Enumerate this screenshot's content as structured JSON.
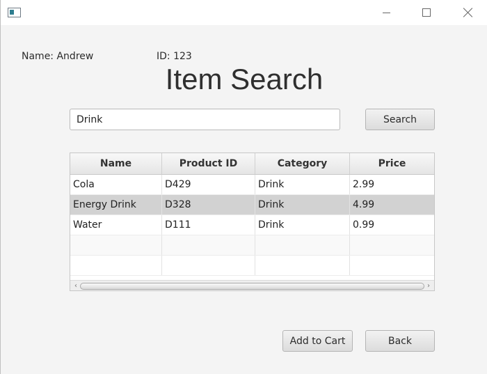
{
  "window": {
    "icon": "app-window-icon",
    "controls": [
      "minimize-icon",
      "maximize-icon",
      "close-icon"
    ]
  },
  "user": {
    "name_label": "Name:",
    "name": "Andrew",
    "id_label": "ID:",
    "id": "123"
  },
  "page": {
    "title": "Item Search"
  },
  "search": {
    "value": "Drink",
    "button_label": "Search"
  },
  "table": {
    "columns": [
      "Name",
      "Product ID",
      "Category",
      "Price"
    ],
    "rows": [
      {
        "name": "Cola",
        "product_id": "D429",
        "category": "Drink",
        "price": "2.99"
      },
      {
        "name": "Energy Drink",
        "product_id": "D328",
        "category": "Drink",
        "price": "4.99"
      },
      {
        "name": "Water",
        "product_id": "D111",
        "category": "Drink",
        "price": "0.99"
      },
      {
        "name": "",
        "product_id": "",
        "category": "",
        "price": ""
      },
      {
        "name": "",
        "product_id": "",
        "category": "",
        "price": ""
      }
    ],
    "selected_row": 2
  },
  "actions": {
    "add_to_cart": "Add to Cart",
    "back": "Back"
  }
}
